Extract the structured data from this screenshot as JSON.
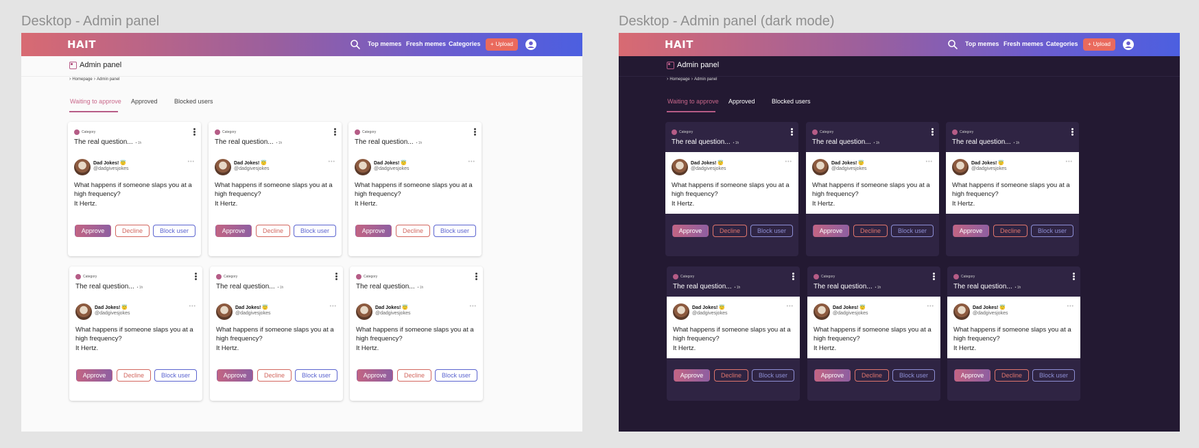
{
  "frames": [
    {
      "title": "Desktop - Admin panel",
      "theme": "light",
      "nav": {
        "logo": "HAIT",
        "links": [
          "Top memes",
          "Fresh memes",
          "Categories"
        ],
        "upload_label": "Upload"
      },
      "header": {
        "title": "Admin panel"
      },
      "breadcrumb": [
        "Homepage",
        "Admin panel"
      ],
      "tabs": [
        {
          "label": "Waiting to approve",
          "active": true
        },
        {
          "label": "Approved",
          "active": false
        },
        {
          "label": "Blocked users",
          "active": false
        }
      ],
      "cards": [
        {
          "category": "Category",
          "title": "The real question...",
          "age": "1h",
          "author": "Dad Jokes! 😇",
          "handle": "@dadgivesjokes",
          "text": "What happens if someone slaps you at a high frequency?",
          "punchline": "It Hertz."
        },
        {
          "category": "Category",
          "title": "The real question...",
          "age": "1h",
          "author": "Dad Jokes! 😇",
          "handle": "@dadgivesjokes",
          "text": "What happens if someone slaps you at a high frequency?",
          "punchline": "It Hertz."
        },
        {
          "category": "Category",
          "title": "The real question...",
          "age": "1h",
          "author": "Dad Jokes! 😇",
          "handle": "@dadgivesjokes",
          "text": "What happens if someone slaps you at a high frequency?",
          "punchline": "It Hertz."
        },
        {
          "category": "Category",
          "title": "The real question...",
          "age": "1h",
          "author": "Dad Jokes! 😇",
          "handle": "@dadgivesjokes",
          "text": "What happens if someone slaps you at a high frequency?",
          "punchline": "It Hertz."
        },
        {
          "category": "Category",
          "title": "The real question...",
          "age": "1h",
          "author": "Dad Jokes! 😇",
          "handle": "@dadgivesjokes",
          "text": "What happens if someone slaps you at a high frequency?",
          "punchline": "It Hertz."
        },
        {
          "category": "Category",
          "title": "The real question...",
          "age": "1h",
          "author": "Dad Jokes! 😇",
          "handle": "@dadgivesjokes",
          "text": "What happens if someone slaps you at a high frequency?",
          "punchline": "It Hertz."
        }
      ],
      "actions": {
        "approve": "Approve",
        "decline": "Decline",
        "block": "Block user"
      }
    },
    {
      "title": "Desktop - Admin panel (dark mode)",
      "theme": "dark",
      "nav": {
        "logo": "HAIT",
        "links": [
          "Top memes",
          "Fresh memes",
          "Categories"
        ],
        "upload_label": "Upload"
      },
      "header": {
        "title": "Admin panel"
      },
      "breadcrumb": [
        "Homepage",
        "Admin panel"
      ],
      "tabs": [
        {
          "label": "Waiting to approve",
          "active": true
        },
        {
          "label": "Approved",
          "active": false
        },
        {
          "label": "Blocked users",
          "active": false
        }
      ],
      "cards": [
        {
          "category": "Category",
          "title": "The real question...",
          "age": "1h",
          "author": "Dad Jokes! 😇",
          "handle": "@dadgivesjokes",
          "text": "What happens if someone slaps you at a high frequency?",
          "punchline": "It Hertz."
        },
        {
          "category": "Category",
          "title": "The real question...",
          "age": "1h",
          "author": "Dad Jokes! 😇",
          "handle": "@dadgivesjokes",
          "text": "What happens if someone slaps you at a high frequency?",
          "punchline": "It Hertz."
        },
        {
          "category": "Category",
          "title": "The real question...",
          "age": "1h",
          "author": "Dad Jokes! 😇",
          "handle": "@dadgivesjokes",
          "text": "What happens if someone slaps you at a high frequency?",
          "punchline": "It Hertz."
        },
        {
          "category": "Category",
          "title": "The real question...",
          "age": "1h",
          "author": "Dad Jokes! 😇",
          "handle": "@dadgivesjokes",
          "text": "What happens if someone slaps you at a high frequency?",
          "punchline": "It Hertz."
        },
        {
          "category": "Category",
          "title": "The real question...",
          "age": "1h",
          "author": "Dad Jokes! 😇",
          "handle": "@dadgivesjokes",
          "text": "What happens if someone slaps you at a high frequency?",
          "punchline": "It Hertz."
        },
        {
          "category": "Category",
          "title": "The real question...",
          "age": "1h",
          "author": "Dad Jokes! 😇",
          "handle": "@dadgivesjokes",
          "text": "What happens if someone slaps you at a high frequency?",
          "punchline": "It Hertz."
        }
      ],
      "actions": {
        "approve": "Approve",
        "decline": "Decline",
        "block": "Block user"
      }
    }
  ],
  "icons": {
    "search": "search-icon",
    "account": "account-icon",
    "admin": "admin-panel-icon",
    "breadcrumb_sep": "chevron-right-icon",
    "card_menu": "kebab-menu-icon",
    "tweet_menu": "more-horizontal-icon",
    "upload": "plus-icon"
  },
  "colors": {
    "nav_gradient": [
      "#d86a72",
      "#9a5f9e",
      "#4c5fe0"
    ],
    "upload_button": "#ea6a5d",
    "accent": "#b75c86",
    "decline": "#d2665e",
    "block": "#5a63cf",
    "light_bg": "#fafafa",
    "dark_bg": "#231932",
    "dark_card": "#2f2443"
  }
}
